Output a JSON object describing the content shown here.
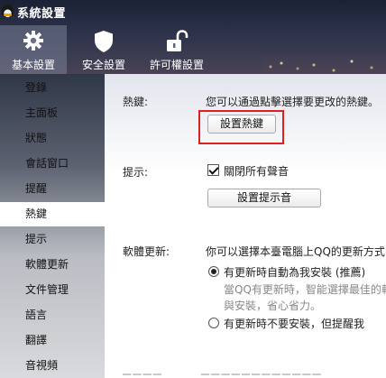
{
  "window": {
    "title": "系統設置"
  },
  "tabs": [
    {
      "label": "基本設置",
      "icon": "gear-icon",
      "active": true
    },
    {
      "label": "安全設置",
      "icon": "shield-icon",
      "active": false
    },
    {
      "label": "許可權設置",
      "icon": "unlock-icon",
      "active": false
    }
  ],
  "sidebar": {
    "items": [
      {
        "label": "登錄"
      },
      {
        "label": "主面板"
      },
      {
        "label": "狀態"
      },
      {
        "label": "會話窗口"
      },
      {
        "label": "提醒"
      },
      {
        "label": "熱鍵",
        "active": true
      },
      {
        "label": "提示"
      },
      {
        "label": "軟體更新"
      },
      {
        "label": "文件管理"
      },
      {
        "label": "語言"
      },
      {
        "label": "翻譯"
      },
      {
        "label": "音視頻"
      }
    ]
  },
  "hotkey": {
    "label": "熱鍵:",
    "desc": "您可以通過點擊選擇要更改的熱鍵。",
    "button": "設置熱鍵"
  },
  "tip": {
    "label": "提示:",
    "checkbox_label": "關閉所有聲音",
    "checked": true,
    "button": "設置提示音"
  },
  "update": {
    "label": "軟體更新:",
    "desc": "你可以選擇本臺電腦上QQ的更新方式:",
    "option1": "有更新時自動為我安裝 (推薦)",
    "option1_note1": "當QQ有更新時，智能選擇最佳的軟",
    "option1_note2": "與安裝，省心省力。",
    "option2": "有更新時不要安裝，但提醒我",
    "selected": 1
  },
  "colors": {
    "highlight_outline": "#e02020",
    "header_bg": "#2b3147",
    "active_tab_bg": "#7880969c"
  }
}
